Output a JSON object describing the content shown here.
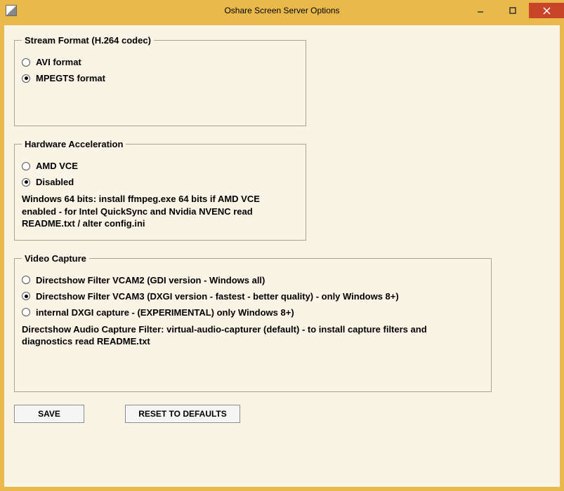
{
  "titlebar": {
    "title": "Oshare Screen Server Options"
  },
  "streamFormat": {
    "legend": "Stream Format (H.264 codec)",
    "options": {
      "avi": "AVI format",
      "mpegts": "MPEGTS format"
    }
  },
  "hwaccel": {
    "legend": "Hardware Acceleration",
    "options": {
      "amd": "AMD VCE",
      "disabled": "Disabled"
    },
    "note": "Windows 64 bits: install ffmpeg.exe 64 bits if AMD VCE enabled - for Intel QuickSync and Nvidia NVENC read README.txt / alter config.ini"
  },
  "videoCapture": {
    "legend": "Video Capture",
    "options": {
      "vcam2": "Directshow Filter VCAM2 (GDI version - Windows all)",
      "vcam3": "Directshow Filter VCAM3 (DXGI version - fastest - better quality) - only Windows 8+)",
      "dxgi": "internal DXGI capture - (EXPERIMENTAL) only Windows 8+)"
    },
    "note": "Directshow Audio Capture Filter: virtual-audio-capturer (default) - to install capture filters and diagnostics read README.txt"
  },
  "buttons": {
    "save": "SAVE",
    "reset": "RESET TO DEFAULTS"
  }
}
